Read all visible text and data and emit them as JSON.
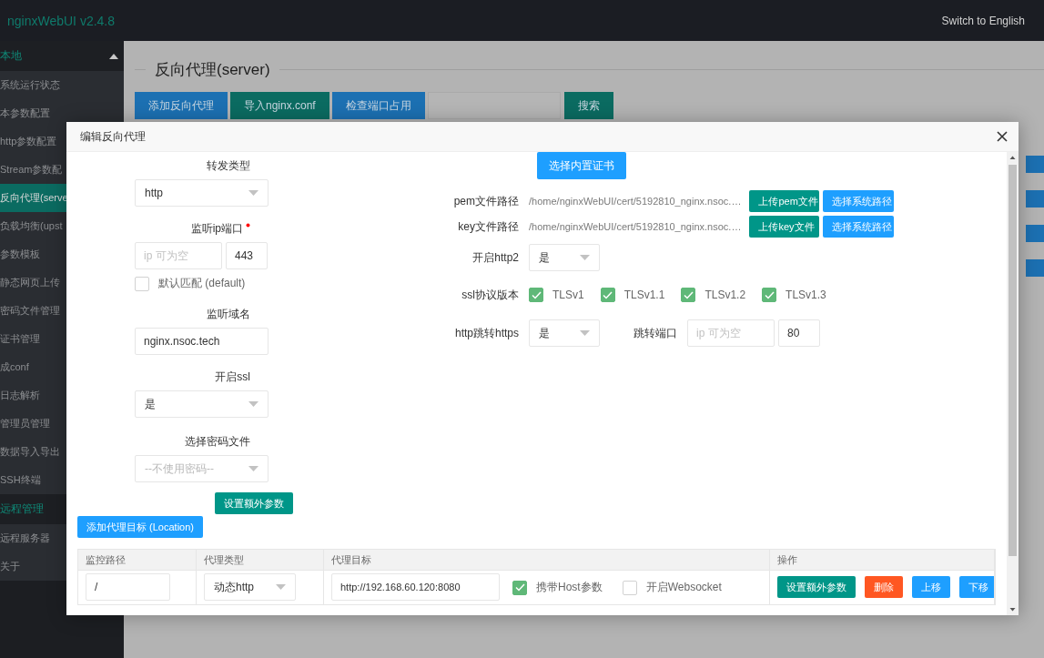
{
  "app": {
    "title": "nginxWebUI v2.4.8",
    "language_link": "Switch to English"
  },
  "sidebar": {
    "groups": [
      {
        "label": "本地",
        "expanded": true,
        "items": [
          {
            "label": "系统运行状态",
            "selected": false
          },
          {
            "label": "本参数配置",
            "selected": false
          },
          {
            "label": "http参数配置",
            "selected": false
          },
          {
            "label": "Stream参数配",
            "selected": false
          },
          {
            "label": "反向代理(serve",
            "selected": true
          },
          {
            "label": "负载均衡(upst",
            "selected": false
          },
          {
            "label": "参数模板",
            "selected": false
          },
          {
            "label": "静态网页上传",
            "selected": false
          },
          {
            "label": "密码文件管理",
            "selected": false
          },
          {
            "label": "证书管理",
            "selected": false
          },
          {
            "label": "成conf",
            "selected": false
          },
          {
            "label": "日志解析",
            "selected": false
          },
          {
            "label": "管理员管理",
            "selected": false
          },
          {
            "label": "数据导入导出",
            "selected": false
          },
          {
            "label": "SSH终端",
            "selected": false
          }
        ]
      },
      {
        "label": "远程管理",
        "items": [
          {
            "label": "远程服务器",
            "selected": false
          },
          {
            "label": "关于",
            "selected": false
          }
        ]
      }
    ]
  },
  "page": {
    "title": "反向代理(server)",
    "toolbar": [
      {
        "label": "添加反向代理",
        "kind": "primary"
      },
      {
        "label": "导入nginx.conf",
        "kind": "success"
      },
      {
        "label": "检查端口占用",
        "kind": "primary"
      }
    ],
    "search_button": "搜索"
  },
  "dialog": {
    "title": "编辑反向代理",
    "left": {
      "proxy_type": {
        "label": "转发类型",
        "value": "http"
      },
      "listen": {
        "label": "监听ip端口",
        "required": true,
        "ip_placeholder": "ip 可为空",
        "port": "443"
      },
      "default_match": {
        "label": "默认匹配 (default)",
        "checked": false
      },
      "server_name": {
        "label": "监听域名",
        "value": "nginx.nsoc.tech"
      },
      "ssl": {
        "label": "开启ssl",
        "value": "是"
      },
      "password_file": {
        "label": "选择密码文件",
        "placeholder": "--不使用密码--"
      },
      "extra_button": "设置额外参数"
    },
    "right": {
      "builtin_cert_button": "选择内置证书",
      "files": [
        {
          "label": "pem文件路径",
          "value": "/home/nginxWebUI/cert/5192810_nginx.nsoc.…",
          "upload": "上传pem文件",
          "browse": "选择系统路径"
        },
        {
          "label": "key文件路径",
          "value": "/home/nginxWebUI/cert/5192810_nginx.nsoc.…",
          "upload": "上传key文件",
          "browse": "选择系统路径"
        }
      ],
      "http2": {
        "label": "开启http2",
        "value": "是"
      },
      "protocols": {
        "label": "ssl协议版本",
        "options": [
          {
            "label": "TLSv1",
            "checked": true
          },
          {
            "label": "TLSv1.1",
            "checked": true
          },
          {
            "label": "TLSv1.2",
            "checked": true
          },
          {
            "label": "TLSv1.3",
            "checked": true
          }
        ]
      },
      "redirect": {
        "label": "http跳转https",
        "value": "是",
        "port_label": "跳转端口",
        "ip_placeholder": "ip 可为空",
        "port": "80"
      }
    },
    "add_location_button": "添加代理目标 (Location)",
    "locations": {
      "columns": [
        "监控路径",
        "代理类型",
        "代理目标",
        "操作"
      ],
      "rows": [
        {
          "path": "/",
          "type": "动态http",
          "target": "http://192.168.60.120:8080",
          "host_param": {
            "label": "携带Host参数",
            "checked": true
          },
          "websocket": {
            "label": "开启Websocket",
            "checked": false
          },
          "actions": [
            {
              "label": "设置额外参数",
              "kind": "success"
            },
            {
              "label": "删除",
              "kind": "danger"
            },
            {
              "label": "上移",
              "kind": "primary"
            },
            {
              "label": "下移",
              "kind": "primary"
            }
          ]
        }
      ]
    }
  }
}
